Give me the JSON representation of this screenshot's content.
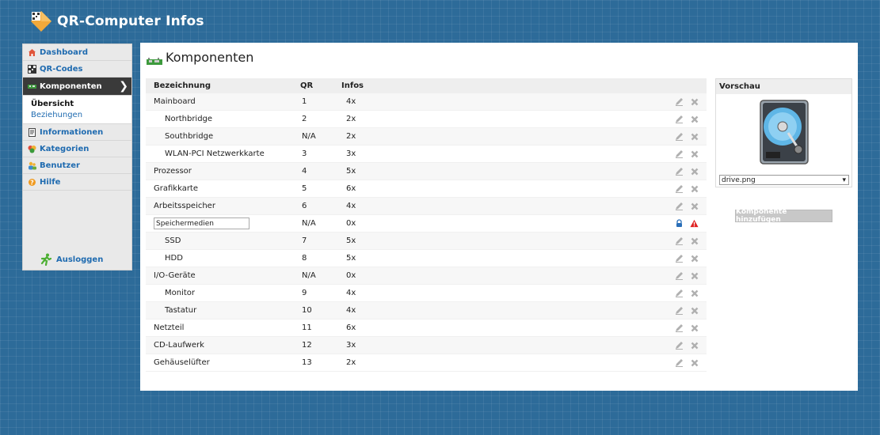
{
  "app": {
    "title": "QR-Computer Infos"
  },
  "sidebar": {
    "items": [
      {
        "label": "Dashboard"
      },
      {
        "label": "QR-Codes"
      },
      {
        "label": "Komponenten"
      },
      {
        "label": "Informationen"
      },
      {
        "label": "Kategorien"
      },
      {
        "label": "Benutzer"
      },
      {
        "label": "Hilfe"
      }
    ],
    "sub_items": [
      {
        "label": "Übersicht"
      },
      {
        "label": "Beziehungen"
      }
    ],
    "logout_label": "Ausloggen"
  },
  "main": {
    "title": "Komponenten",
    "columns": {
      "name": "Bezeichnung",
      "qr": "QR",
      "infos": "Infos"
    },
    "rows": [
      {
        "name": "Mainboard",
        "qr": "1",
        "infos": "4x"
      },
      {
        "name": "Northbridge",
        "qr": "2",
        "infos": "2x"
      },
      {
        "name": "Southbridge",
        "qr": "N/A",
        "infos": "2x"
      },
      {
        "name": "WLAN-PCI Netzwerkkarte",
        "qr": "3",
        "infos": "3x"
      },
      {
        "name": "Prozessor",
        "qr": "4",
        "infos": "5x"
      },
      {
        "name": "Grafikkarte",
        "qr": "5",
        "infos": "6x"
      },
      {
        "name": "Arbeitsspeicher",
        "qr": "6",
        "infos": "4x"
      },
      {
        "name": "Speichermedien",
        "qr": "N/A",
        "infos": "0x"
      },
      {
        "name": "SSD",
        "qr": "7",
        "infos": "5x"
      },
      {
        "name": "HDD",
        "qr": "8",
        "infos": "5x"
      },
      {
        "name": "I/O-Geräte",
        "qr": "N/A",
        "infos": "0x"
      },
      {
        "name": "Monitor",
        "qr": "9",
        "infos": "4x"
      },
      {
        "name": "Tastatur",
        "qr": "10",
        "infos": "4x"
      },
      {
        "name": "Netzteil",
        "qr": "11",
        "infos": "6x"
      },
      {
        "name": "CD-Laufwerk",
        "qr": "12",
        "infos": "3x"
      },
      {
        "name": "Gehäuselüfter",
        "qr": "13",
        "infos": "2x"
      }
    ]
  },
  "preview": {
    "title": "Vorschau",
    "image_select": "drive.png"
  },
  "add_button_label": "Komponente hinzufügen",
  "colors": {
    "link": "#1f6bb0",
    "active_nav": "#3a3a3a",
    "warning": "#e02020",
    "lock": "#2a6fb8"
  }
}
